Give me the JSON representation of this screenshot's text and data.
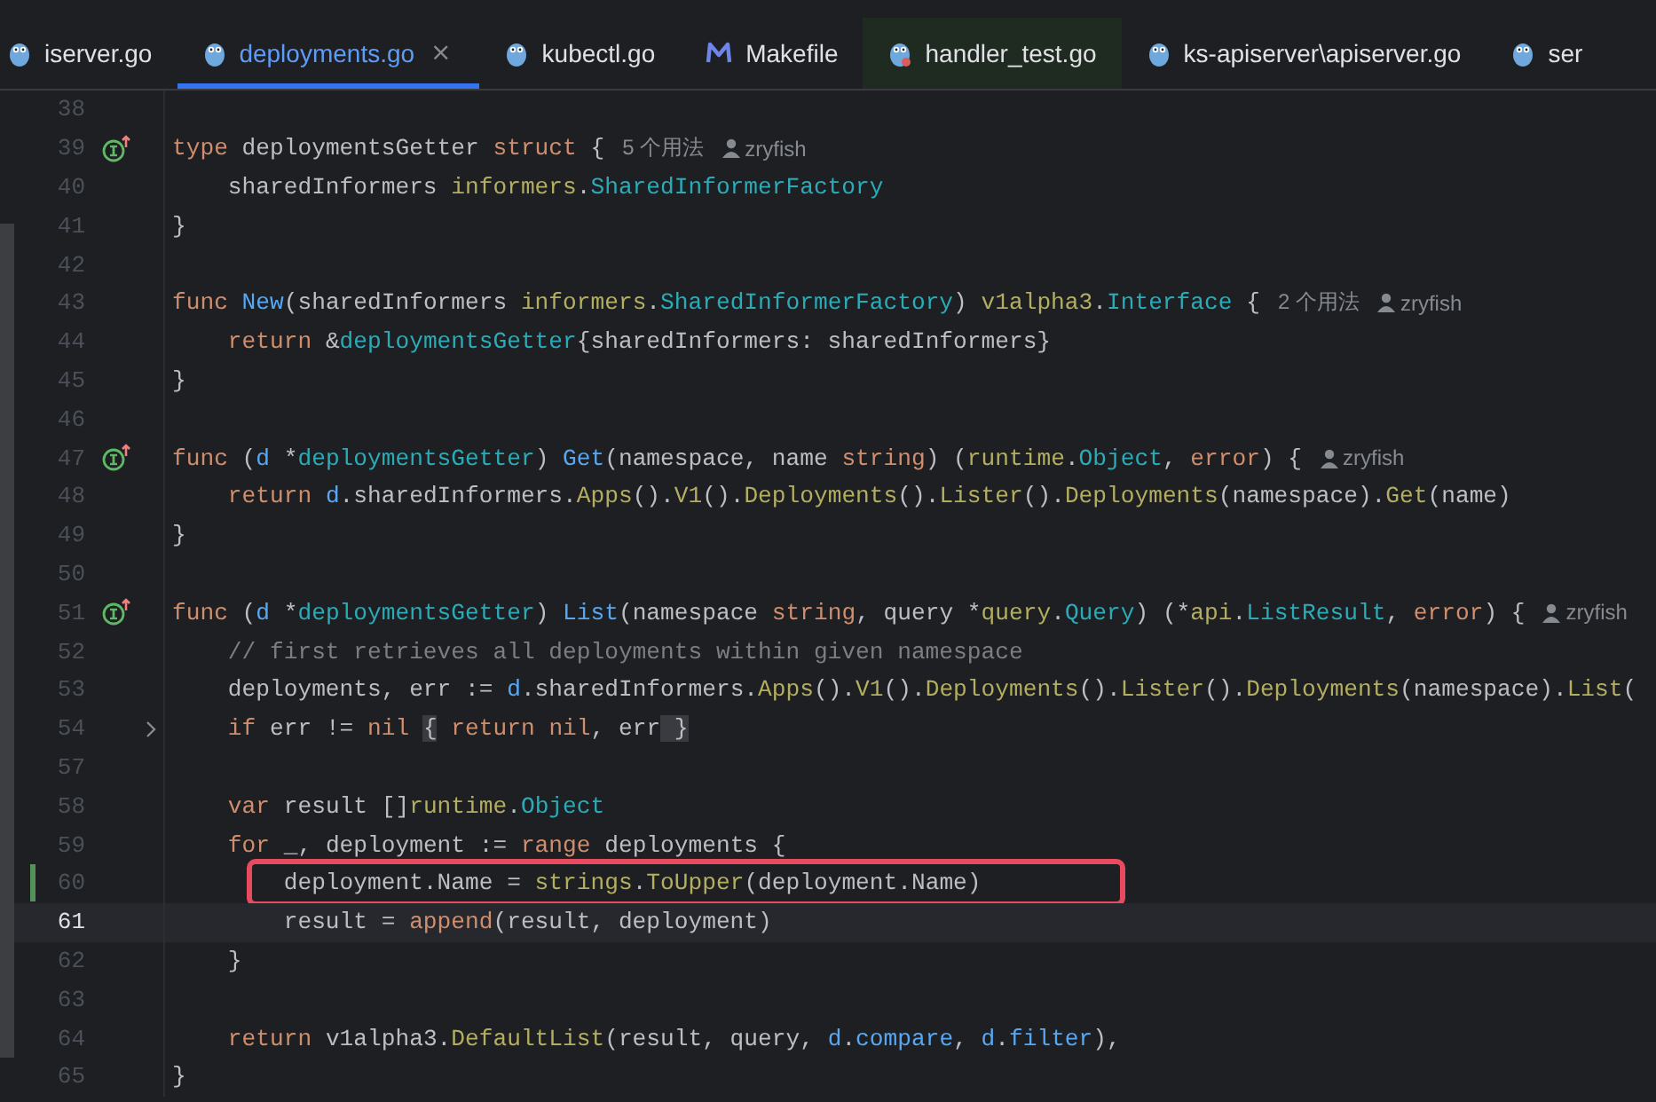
{
  "tabs": [
    {
      "label": "iserver.go",
      "kind": "go",
      "selected": false
    },
    {
      "label": "deployments.go",
      "kind": "go",
      "selected": true,
      "close": "×"
    },
    {
      "label": "kubectl.go",
      "kind": "go",
      "selected": false
    },
    {
      "label": "Makefile",
      "kind": "make",
      "selected": false
    },
    {
      "label": "handler_test.go",
      "kind": "test",
      "selected": false
    },
    {
      "label": "ks-apiserver\\apiserver.go",
      "kind": "go",
      "selected": false
    },
    {
      "label": "ser",
      "kind": "go",
      "selected": false
    }
  ],
  "editor": {
    "lines": [
      {
        "number": "38",
        "implements": false,
        "folded": false,
        "changed": false,
        "current": false,
        "highlighted": false
      },
      {
        "number": "39",
        "implements": true,
        "folded": false,
        "changed": false,
        "current": false,
        "highlighted": false,
        "tokens": [
          {
            "kind": "kw",
            "text": "type "
          },
          {
            "kind": "plain",
            "text": "deploymentsGetter "
          },
          {
            "kind": "kw",
            "text": "struct "
          },
          {
            "kind": "plain",
            "text": "{"
          }
        ],
        "hint": {
          "usages": "5 个用法",
          "author": "zryfish"
        }
      },
      {
        "number": "40",
        "implements": false,
        "folded": false,
        "changed": false,
        "current": false,
        "highlighted": false,
        "tokens": [
          {
            "kind": "plain",
            "text": "    sharedInformers "
          },
          {
            "kind": "pkg",
            "text": "informers"
          },
          {
            "kind": "plain",
            "text": "."
          },
          {
            "kind": "type",
            "text": "SharedInformerFactory"
          }
        ]
      },
      {
        "number": "41",
        "implements": false,
        "folded": false,
        "changed": false,
        "current": false,
        "highlighted": false,
        "tokens": [
          {
            "kind": "plain",
            "text": "}"
          }
        ]
      },
      {
        "number": "42",
        "implements": false,
        "folded": false,
        "changed": false,
        "current": false,
        "highlighted": false
      },
      {
        "number": "43",
        "implements": false,
        "folded": false,
        "changed": false,
        "current": false,
        "highlighted": false,
        "tokens": [
          {
            "kind": "kw",
            "text": "func "
          },
          {
            "kind": "fn",
            "text": "New"
          },
          {
            "kind": "plain",
            "text": "(sharedInformers "
          },
          {
            "kind": "pkg",
            "text": "informers"
          },
          {
            "kind": "plain",
            "text": "."
          },
          {
            "kind": "type",
            "text": "SharedInformerFactory"
          },
          {
            "kind": "plain",
            "text": ") "
          },
          {
            "kind": "pkg",
            "text": "v1alpha3"
          },
          {
            "kind": "plain",
            "text": "."
          },
          {
            "kind": "type",
            "text": "Interface"
          },
          {
            "kind": "plain",
            "text": " {"
          }
        ],
        "hint": {
          "usages": "2 个用法",
          "author": "zryfish"
        }
      },
      {
        "number": "44",
        "implements": false,
        "folded": false,
        "changed": false,
        "current": false,
        "highlighted": false,
        "tokens": [
          {
            "kind": "kw",
            "text": "    return "
          },
          {
            "kind": "plain",
            "text": "&"
          },
          {
            "kind": "type",
            "text": "deploymentsGetter"
          },
          {
            "kind": "plain",
            "text": "{sharedInformers: sharedInformers}"
          }
        ]
      },
      {
        "number": "45",
        "implements": false,
        "folded": false,
        "changed": false,
        "current": false,
        "highlighted": false,
        "tokens": [
          {
            "kind": "plain",
            "text": "}"
          }
        ]
      },
      {
        "number": "46",
        "implements": false,
        "folded": false,
        "changed": false,
        "current": false,
        "highlighted": false
      },
      {
        "number": "47",
        "implements": true,
        "folded": false,
        "changed": false,
        "current": false,
        "highlighted": false,
        "tokens": [
          {
            "kind": "kw",
            "text": "func "
          },
          {
            "kind": "plain",
            "text": "("
          },
          {
            "kind": "recv",
            "text": "d "
          },
          {
            "kind": "plain",
            "text": "*"
          },
          {
            "kind": "type",
            "text": "deploymentsGetter"
          },
          {
            "kind": "plain",
            "text": ") "
          },
          {
            "kind": "fn",
            "text": "Get"
          },
          {
            "kind": "plain",
            "text": "(namespace, name "
          },
          {
            "kind": "kw",
            "text": "string"
          },
          {
            "kind": "plain",
            "text": ") ("
          },
          {
            "kind": "pkg",
            "text": "runtime"
          },
          {
            "kind": "plain",
            "text": "."
          },
          {
            "kind": "type",
            "text": "Object"
          },
          {
            "kind": "plain",
            "text": ", "
          },
          {
            "kind": "kw",
            "text": "error"
          },
          {
            "kind": "plain",
            "text": ") {"
          }
        ],
        "hint": {
          "author": "zryfish"
        }
      },
      {
        "number": "48",
        "implements": false,
        "folded": false,
        "changed": false,
        "current": false,
        "highlighted": false,
        "tokens": [
          {
            "kind": "kw",
            "text": "    return "
          },
          {
            "kind": "recv",
            "text": "d"
          },
          {
            "kind": "plain",
            "text": ".sharedInformers."
          },
          {
            "kind": "pkg",
            "text": "Apps"
          },
          {
            "kind": "plain",
            "text": "()."
          },
          {
            "kind": "pkg",
            "text": "V1"
          },
          {
            "kind": "plain",
            "text": "()."
          },
          {
            "kind": "pkg",
            "text": "Deployments"
          },
          {
            "kind": "plain",
            "text": "()."
          },
          {
            "kind": "pkg",
            "text": "Lister"
          },
          {
            "kind": "plain",
            "text": "()."
          },
          {
            "kind": "pkg",
            "text": "Deployments"
          },
          {
            "kind": "plain",
            "text": "(namespace)."
          },
          {
            "kind": "pkg",
            "text": "Get"
          },
          {
            "kind": "plain",
            "text": "(name)"
          }
        ]
      },
      {
        "number": "49",
        "implements": false,
        "folded": false,
        "changed": false,
        "current": false,
        "highlighted": false,
        "tokens": [
          {
            "kind": "plain",
            "text": "}"
          }
        ]
      },
      {
        "number": "50",
        "implements": false,
        "folded": false,
        "changed": false,
        "current": false,
        "highlighted": false
      },
      {
        "number": "51",
        "implements": true,
        "folded": false,
        "changed": false,
        "current": false,
        "highlighted": false,
        "tokens": [
          {
            "kind": "kw",
            "text": "func "
          },
          {
            "kind": "plain",
            "text": "("
          },
          {
            "kind": "recv",
            "text": "d "
          },
          {
            "kind": "plain",
            "text": "*"
          },
          {
            "kind": "type",
            "text": "deploymentsGetter"
          },
          {
            "kind": "plain",
            "text": ") "
          },
          {
            "kind": "fn",
            "text": "List"
          },
          {
            "kind": "plain",
            "text": "(namespace "
          },
          {
            "kind": "kw",
            "text": "string"
          },
          {
            "kind": "plain",
            "text": ", query *"
          },
          {
            "kind": "pkg",
            "text": "query"
          },
          {
            "kind": "plain",
            "text": "."
          },
          {
            "kind": "type",
            "text": "Query"
          },
          {
            "kind": "plain",
            "text": ") (*"
          },
          {
            "kind": "pkg",
            "text": "api"
          },
          {
            "kind": "plain",
            "text": "."
          },
          {
            "kind": "type",
            "text": "ListResult"
          },
          {
            "kind": "plain",
            "text": ", "
          },
          {
            "kind": "kw",
            "text": "error"
          },
          {
            "kind": "plain",
            "text": ") {"
          }
        ],
        "hint": {
          "author": "zryfish"
        }
      },
      {
        "number": "52",
        "implements": false,
        "folded": false,
        "changed": false,
        "current": false,
        "highlighted": false,
        "tokens": [
          {
            "kind": "comment",
            "text": "    // first retrieves all deployments within given namespace"
          }
        ]
      },
      {
        "number": "53",
        "implements": false,
        "folded": false,
        "changed": false,
        "current": false,
        "highlighted": false,
        "tokens": [
          {
            "kind": "plain",
            "text": "    deployments, err := "
          },
          {
            "kind": "recv",
            "text": "d"
          },
          {
            "kind": "plain",
            "text": ".sharedInformers."
          },
          {
            "kind": "pkg",
            "text": "Apps"
          },
          {
            "kind": "plain",
            "text": "()."
          },
          {
            "kind": "pkg",
            "text": "V1"
          },
          {
            "kind": "plain",
            "text": "()."
          },
          {
            "kind": "pkg",
            "text": "Deployments"
          },
          {
            "kind": "plain",
            "text": "()."
          },
          {
            "kind": "pkg",
            "text": "Lister"
          },
          {
            "kind": "plain",
            "text": "()."
          },
          {
            "kind": "pkg",
            "text": "Deployments"
          },
          {
            "kind": "plain",
            "text": "(namespace)."
          },
          {
            "kind": "pkg",
            "text": "List"
          },
          {
            "kind": "plain",
            "text": "("
          }
        ]
      },
      {
        "number": "54",
        "implements": false,
        "folded": true,
        "changed": false,
        "current": false,
        "highlighted": false,
        "tokens": [
          {
            "kind": "kw",
            "text": "    if "
          },
          {
            "kind": "plain",
            "text": "err != "
          },
          {
            "kind": "kw",
            "text": "nil "
          },
          {
            "kind": "fold",
            "text": "{"
          },
          {
            "kind": "kw",
            "text": " return nil"
          },
          {
            "kind": "plain",
            "text": ", err"
          },
          {
            "kind": "fold",
            "text": " }"
          }
        ]
      },
      {
        "number": "57",
        "implements": false,
        "folded": false,
        "changed": false,
        "current": false,
        "highlighted": false
      },
      {
        "number": "58",
        "implements": false,
        "folded": false,
        "changed": false,
        "current": false,
        "highlighted": false,
        "tokens": [
          {
            "kind": "kw",
            "text": "    var "
          },
          {
            "kind": "plain",
            "text": "result []"
          },
          {
            "kind": "pkg",
            "text": "runtime"
          },
          {
            "kind": "plain",
            "text": "."
          },
          {
            "kind": "type",
            "text": "Object"
          }
        ]
      },
      {
        "number": "59",
        "implements": false,
        "folded": false,
        "changed": false,
        "current": false,
        "highlighted": false,
        "tokens": [
          {
            "kind": "kw",
            "text": "    for "
          },
          {
            "kind": "plain",
            "text": "_, deployment := "
          },
          {
            "kind": "kw",
            "text": "range "
          },
          {
            "kind": "plain",
            "text": "deployments {"
          }
        ]
      },
      {
        "number": "60",
        "implements": false,
        "folded": false,
        "changed": true,
        "current": false,
        "highlighted": true,
        "tokens": [
          {
            "kind": "plain",
            "text": "        deployment.Name = "
          },
          {
            "kind": "pkg",
            "text": "strings"
          },
          {
            "kind": "plain",
            "text": "."
          },
          {
            "kind": "pkg",
            "text": "ToUpper"
          },
          {
            "kind": "plain",
            "text": "(deployment.Name)"
          }
        ]
      },
      {
        "number": "61",
        "implements": false,
        "folded": false,
        "changed": false,
        "current": true,
        "highlighted": false,
        "tokens": [
          {
            "kind": "plain",
            "text": "        result = "
          },
          {
            "kind": "kw",
            "text": "append"
          },
          {
            "kind": "plain",
            "text": "(result, deployment)"
          }
        ]
      },
      {
        "number": "62",
        "implements": false,
        "folded": false,
        "changed": false,
        "current": false,
        "highlighted": false,
        "tokens": [
          {
            "kind": "plain",
            "text": "    }"
          }
        ]
      },
      {
        "number": "63",
        "implements": false,
        "folded": false,
        "changed": false,
        "current": false,
        "highlighted": false
      },
      {
        "number": "64",
        "implements": false,
        "folded": false,
        "changed": false,
        "current": false,
        "highlighted": false,
        "tokens": [
          {
            "kind": "kw",
            "text": "    return "
          },
          {
            "kind": "plain",
            "text": "v1alpha3."
          },
          {
            "kind": "pkg",
            "text": "DefaultList"
          },
          {
            "kind": "plain",
            "text": "(result, query, "
          },
          {
            "kind": "recv",
            "text": "d"
          },
          {
            "kind": "plain",
            "text": "."
          },
          {
            "kind": "recv",
            "text": "compare"
          },
          {
            "kind": "plain",
            "text": ", "
          },
          {
            "kind": "recv",
            "text": "d"
          },
          {
            "kind": "plain",
            "text": "."
          },
          {
            "kind": "recv",
            "text": "filter"
          },
          {
            "kind": "plain",
            "text": "),"
          }
        ]
      },
      {
        "number": "65",
        "implements": false,
        "folded": false,
        "changed": false,
        "current": false,
        "highlighted": false,
        "tokens": [
          {
            "kind": "plain",
            "text": "}"
          }
        ]
      }
    ]
  }
}
